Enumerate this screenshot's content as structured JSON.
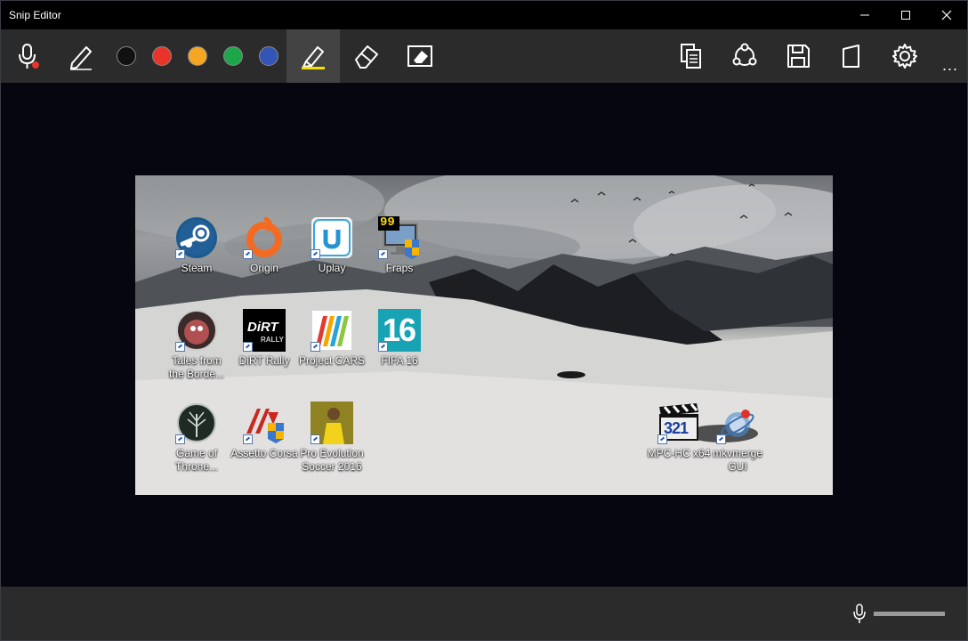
{
  "window": {
    "title": "Snip Editor"
  },
  "toolbar": {
    "colors": [
      "#111111",
      "#e8352a",
      "#f5a623",
      "#1ea64b",
      "#3355b5"
    ],
    "icons": [
      "microphone-icon",
      "pen-icon",
      "highlighter-icon",
      "eraser-icon",
      "erase-all-icon",
      "copy-icon",
      "share-icon",
      "save-icon",
      "open-snip-icon",
      "settings-icon"
    ],
    "more_label": "..."
  },
  "desktop": {
    "icons": [
      {
        "label": "Steam"
      },
      {
        "label": "Origin"
      },
      {
        "label": "Uplay"
      },
      {
        "label": "Fraps"
      },
      {
        "label": "Tales from the Borde..."
      },
      {
        "label": "DiRT Rally"
      },
      {
        "label": "Project CARS"
      },
      {
        "label": "FIFA 16"
      },
      {
        "label": "Game of Throne..."
      },
      {
        "label": "Assetto Corsa"
      },
      {
        "label": "Pro Evolution Soccer 2016"
      },
      {
        "label": "MPC-HC x64"
      },
      {
        "label": "mkvmerge GUI"
      }
    ],
    "fraps_badge": "99",
    "fifa_badge": "16",
    "mpc_badge": "321",
    "dirt_badge": "DiRT",
    "dirt_sub": "RALLY"
  },
  "bottom": {
    "icons": [
      "microphone-icon"
    ],
    "volume": 1.0
  }
}
